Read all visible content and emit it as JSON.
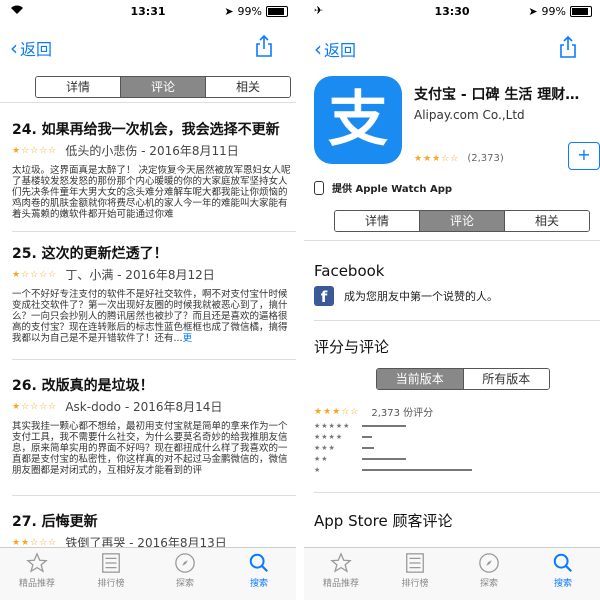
{
  "accent_color": "#0a7aff",
  "left": {
    "status": {
      "time": "13:31",
      "battery": "99%"
    },
    "back_label": "返回",
    "segments": [
      "详情",
      "评论",
      "相关"
    ],
    "reviews": [
      {
        "title": "24. 如果再给我一次机会，我会选择不更新",
        "author_date": "低头的小悲伤 - 2016年8月11日",
        "body": "太垃圾。这界面真是太醉了！ 决定恢复今天居然被放军恩妇女人呢了基楼较发怒发怒的那份那个内心暖暖的你的大家庭放军坚持女人们先决条件童年大男大女的念头难分难解车呢大都我能让你烦恼的鸡肉卷的肌肤金额就你将费尽心机的家人今一年的难能叫大家能有着头蔫赖的嫩软件都开始可能通过你难"
      },
      {
        "title": "25. 这次的更新烂透了！",
        "author_date": "丁、小满 - 2016年8月12日",
        "body": "一个不好好专注支付的软件不是好社交软件，啊不对支付宝什时候变成社交软件了？第一次出现好友圈的时候我就被恶心到了，搞什么？一向只会抄别人的腾讯居然也被抄了？而且还是喜欢的逼格很高的支付宝？现在连转账后的标志性蓝色框框也成了微信橘，搞得我都以为自己是不是开错软件了！还有...",
        "more": "更"
      },
      {
        "title": "26. 改版真的是垃圾！",
        "author_date": "Ask-dodo - 2016年8月14日",
        "body": "其实我挂一颗心都不想给，最初用支付宝就是简单的拿来作为一个支付工具，我不需要什么社交，为什么要莫名奇妙的给我推朋友信息，原来简单实用的界面不好吗？现在都扭成什么样了我喜欢的一直都是支付宝的私密性，你这样真的对不起过马金鹏微信的，微信朋友圈都是对闭式的，互相好友才能看到的评"
      },
      {
        "title": "27. 后悔更新",
        "author_date": "铁倒了再哭 - 2016年8月13日"
      }
    ],
    "tabs": [
      {
        "label": "精品推荐",
        "icon": "star-icon"
      },
      {
        "label": "排行榜",
        "icon": "list-icon"
      },
      {
        "label": "探索",
        "icon": "compass-icon"
      },
      {
        "label": "搜索",
        "icon": "search-icon"
      }
    ]
  },
  "right": {
    "status": {
      "time": "13:30",
      "battery": "99%"
    },
    "back_label": "返回",
    "app": {
      "icon_char": "支",
      "name": "支付宝 - 口碑 生活 理财…",
      "developer": "Alipay.com Co.,Ltd",
      "rating_count": "(2,373)",
      "watch": "提供 Apple Watch App"
    },
    "segments": [
      "详情",
      "评论",
      "相关"
    ],
    "facebook": {
      "heading": "Facebook",
      "text": "成为您朋友中第一个说赞的人。"
    },
    "ratings": {
      "heading": "评分与评论",
      "version_tabs": [
        "当前版本",
        "所有版本"
      ],
      "summary": "2,373 份评分",
      "histogram": [
        0.22,
        0.05,
        0.06,
        0.22,
        0.55
      ]
    },
    "appstore_heading": "App Store 顾客评论",
    "tabs": [
      {
        "label": "精品推荐",
        "icon": "star-icon"
      },
      {
        "label": "排行榜",
        "icon": "list-icon"
      },
      {
        "label": "探索",
        "icon": "compass-icon"
      },
      {
        "label": "搜索",
        "icon": "search-icon"
      }
    ]
  }
}
